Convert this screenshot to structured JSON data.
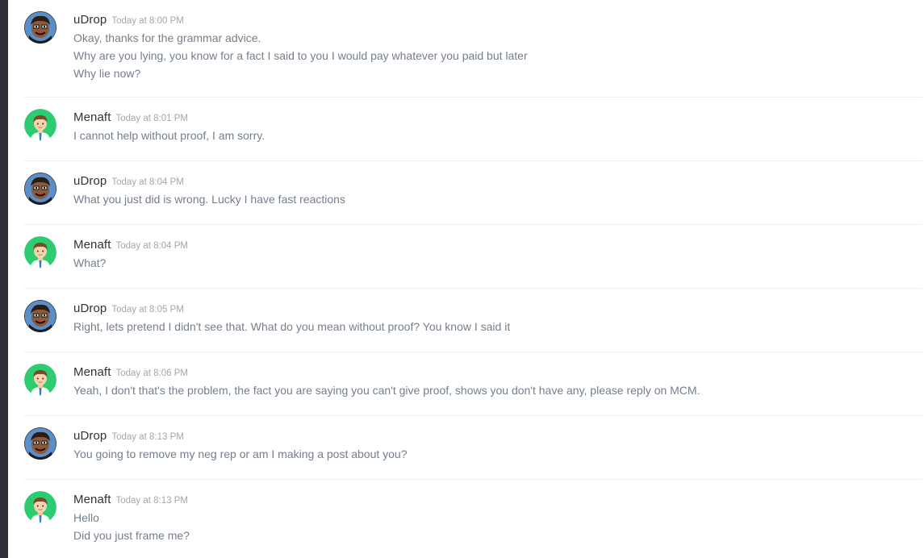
{
  "messages": [
    {
      "author": "uDrop",
      "avatar": "udrop-avatar",
      "time": "Today at 8:00 PM",
      "lines": [
        "Okay, thanks for the grammar advice.",
        "Why are you lying, you know for a fact I said to you I would pay whatever you paid but later",
        "Why lie now?"
      ]
    },
    {
      "author": "Menaft",
      "avatar": "menaft-avatar",
      "time": "Today at 8:01 PM",
      "lines": [
        "I cannot help without proof, I am sorry."
      ]
    },
    {
      "author": "uDrop",
      "avatar": "udrop-avatar",
      "time": "Today at 8:04 PM",
      "lines": [
        "What you just did is wrong. Lucky I have fast reactions"
      ]
    },
    {
      "author": "Menaft",
      "avatar": "menaft-avatar",
      "time": "Today at 8:04 PM",
      "lines": [
        "What?"
      ]
    },
    {
      "author": "uDrop",
      "avatar": "udrop-avatar",
      "time": "Today at 8:05 PM",
      "lines": [
        "Right, lets pretend I didn't see that. What do you mean without proof? You know I said it"
      ]
    },
    {
      "author": "Menaft",
      "avatar": "menaft-avatar",
      "time": "Today at 8:06 PM",
      "lines": [
        "Yeah, I don't that's the problem, the fact you are saying you can't give proof, shows you don't have any, please reply on MCM."
      ]
    },
    {
      "author": "uDrop",
      "avatar": "udrop-avatar",
      "time": "Today at 8:13 PM",
      "lines": [
        "You going to remove my neg rep or am I making a post about you?"
      ]
    },
    {
      "author": "Menaft",
      "avatar": "menaft-avatar",
      "time": "Today at 8:13 PM",
      "lines": [
        "Hello",
        "Did you just frame me?"
      ]
    }
  ],
  "colors": {
    "username": "#2e3338",
    "timestamp": "#a3a6aa",
    "message_text": "#737f8d",
    "divider": "#eceeef",
    "sidebar_strip": "#2f3136",
    "menaft_avatar_bg": "#2ecc71",
    "udrop_avatar_bg": "#5b8fc9"
  }
}
